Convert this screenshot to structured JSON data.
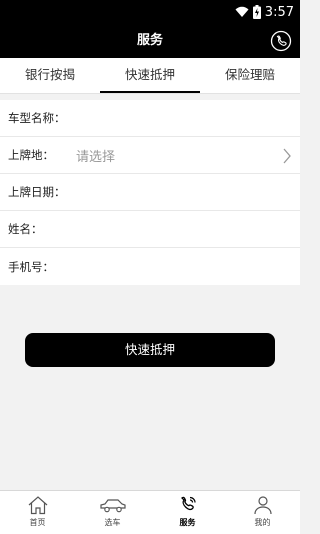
{
  "status_bar": {
    "time": "3:57",
    "icons": [
      "wifi-icon",
      "battery-charging-icon"
    ]
  },
  "app_bar": {
    "title": "服务",
    "action_icon": "phone-icon"
  },
  "tabs": [
    {
      "label": "银行按揭",
      "active": false
    },
    {
      "label": "快速抵押",
      "active": true
    },
    {
      "label": "保险理赔",
      "active": false
    }
  ],
  "form": {
    "car_model": {
      "label": "车型名称：",
      "value": ""
    },
    "plate_location": {
      "label": "上牌地：",
      "placeholder": "请选择"
    },
    "plate_date": {
      "label": "上牌日期：",
      "value": ""
    },
    "name": {
      "label": "姓名：",
      "value": ""
    },
    "phone": {
      "label": "手机号：",
      "value": ""
    }
  },
  "submit": {
    "label": "快速抵押"
  },
  "bottom_nav": [
    {
      "label": "首页",
      "icon": "home-icon",
      "active": false
    },
    {
      "label": "选车",
      "icon": "car-icon",
      "active": false
    },
    {
      "label": "服务",
      "icon": "phone-icon",
      "active": true
    },
    {
      "label": "我的",
      "icon": "user-icon",
      "active": false
    }
  ]
}
